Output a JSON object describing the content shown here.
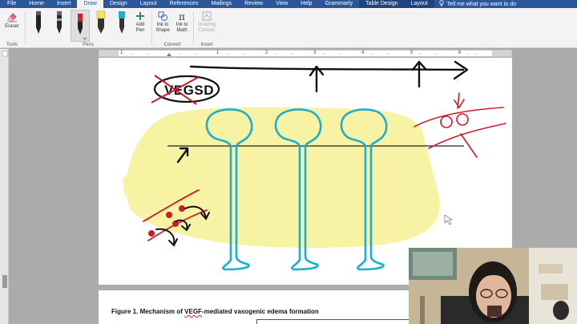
{
  "ribbon": {
    "tabs": [
      {
        "label": "File",
        "active": false
      },
      {
        "label": "Home",
        "active": false
      },
      {
        "label": "Insert",
        "active": false
      },
      {
        "label": "Draw",
        "active": true
      },
      {
        "label": "Design",
        "active": false
      },
      {
        "label": "Layout",
        "active": false
      },
      {
        "label": "References",
        "active": false
      },
      {
        "label": "Mailings",
        "active": false
      },
      {
        "label": "Review",
        "active": false
      },
      {
        "label": "View",
        "active": false
      },
      {
        "label": "Help",
        "active": false
      },
      {
        "label": "Grammarly",
        "active": false
      },
      {
        "label": "Table Design",
        "active": false
      },
      {
        "label": "Layout",
        "active": false
      }
    ],
    "tell_me": "Tell me what you want to do",
    "tools": {
      "eraser_label": "Eraser",
      "group_label": "Tools"
    },
    "pens": {
      "group_label": "Pens",
      "add_pen_line1": "Add",
      "add_pen_line2": "Pen"
    },
    "convert": {
      "ink_to_shape_line1": "Ink to",
      "ink_to_shape_line2": "Shape",
      "ink_to_math_line1": "Ink to",
      "ink_to_math_line2": "Math",
      "group_label": "Convert"
    },
    "insert": {
      "drawing_canvas_line1": "Drawing",
      "drawing_canvas_line2": "Canvas",
      "group_label": "Insert"
    }
  },
  "ruler": {
    "numbers": [
      "1",
      "1",
      "2",
      "3",
      "4",
      "5",
      "6"
    ]
  },
  "document": {
    "annotation": "VEGSD",
    "caption_prefix": "Figure 1. Mechanism of ",
    "caption_vegf": "VEGF",
    "caption_suffix": "-mediated vasogenic edema formation"
  },
  "colors": {
    "ribbon_blue": "#2b579a",
    "ink_blue": "#1aaed0",
    "ink_red": "#cc1b2b",
    "highlight_yellow": "#f7f29a",
    "ink_black": "#111111"
  }
}
